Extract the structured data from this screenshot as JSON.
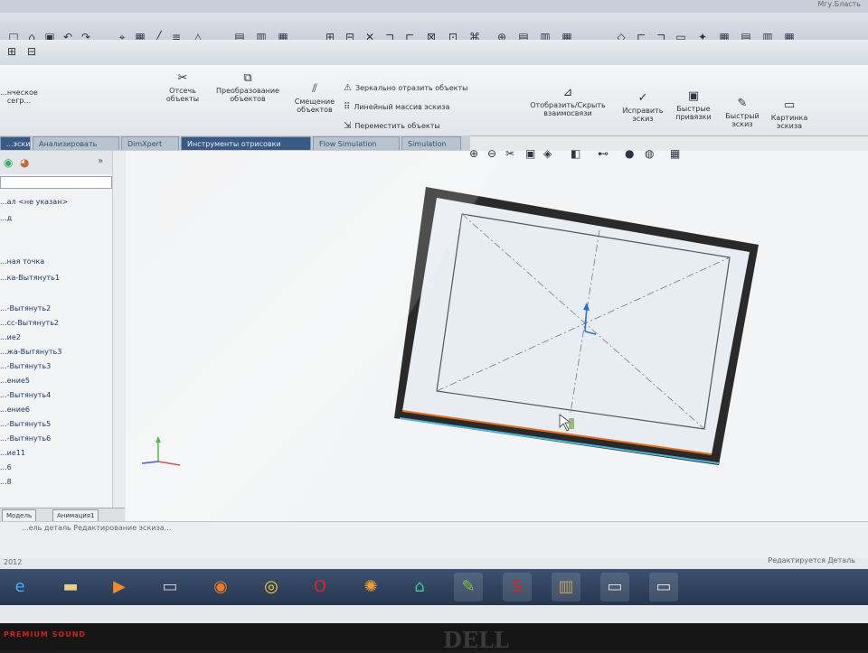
{
  "window": {
    "title_right": "Мгу.Бласть"
  },
  "ribbon": {
    "tool_trim": "Отсечь\nобъекты",
    "tool_transform": "Преобразование\nобъектов",
    "tool_offset": "Смещение\nобъектов",
    "tool_mirror": "Зеркально отразить объекты",
    "tool_linear_pattern": "Линейный массив эскиза",
    "tool_move": "Переместить объекты",
    "tool_show_hide": "Отобразить/Скрыть\nвзаимосвязи",
    "tool_repair": "Исправить\nэскиз",
    "tool_quick_snaps": "Быстрые\nпривязки",
    "tool_rapid_sketch": "Быстрый\nэскиз",
    "tool_sketch_picture": "Картинка\nэскиза",
    "tool_left_cut": "...нческое\nсегр..."
  },
  "tabs": [
    {
      "label": "...эскиз",
      "dark": true
    },
    {
      "label": "Анализировать",
      "dark": false
    },
    {
      "label": "DimXpert",
      "dark": false
    },
    {
      "label": "Инструменты отрисовки",
      "dark": true
    },
    {
      "label": "Flow Simulation",
      "dark": false
    },
    {
      "label": "Simulation",
      "dark": false
    }
  ],
  "feature_tree": {
    "items": [
      "...ал <не указан>",
      "...д",
      "...ная точка",
      "...ка-Вытянуть1",
      "...-Вытянуть2",
      "...сс-Вытянуть2",
      "...ие2",
      "...жа-Вытянуть3",
      "...-Вытянуть3",
      "...ение5",
      "...-Вытянуть4",
      "...ение6",
      "...-Вытянуть5",
      "...-Вытянуть6",
      "...ие11",
      "...6",
      "...8"
    ],
    "bottom_tabs": [
      "Модель",
      "Анимация1"
    ]
  },
  "status": {
    "left_text": "...ель деталь Редактирование эскиза...",
    "year": "2012",
    "right_text": "Редактируется Деталь"
  },
  "taskbar": {
    "icons": [
      "ie-icon",
      "folder-icon",
      "media-player-icon",
      "app-icon",
      "firefox-icon",
      "chrome-icon",
      "opera-icon",
      "blender-icon",
      "home-icon",
      "paint-icon",
      "solidworks-icon",
      "files-icon",
      "window-icon",
      "window2-icon"
    ]
  },
  "bezel": {
    "brand_text": "PREMIUM SOUND",
    "logo_text": "DELL"
  },
  "colors": {
    "accent": "#3a5a86",
    "edge_orange": "#e07020",
    "model_frame": "#2a2a2a"
  }
}
